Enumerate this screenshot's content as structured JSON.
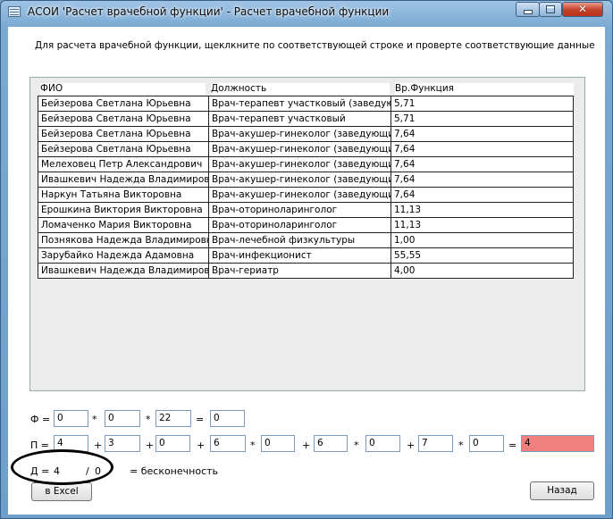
{
  "window": {
    "title": "АСОИ 'Расчет врачебной функции' - Расчет врачебной функции",
    "icon": "app-window-icon"
  },
  "instruction": "Для расчета врачебной функции, щеклкните по соответствующей строке и проверте соответствующие данные",
  "grid": {
    "headers": [
      "ФИО",
      "Должность",
      "Вр.Функция"
    ],
    "rows": [
      [
        "Бейзерова Светлана Юрьевна",
        "Врач-терапевт участковый (заведующи",
        "5,71"
      ],
      [
        "Бейзерова Светлана Юрьевна",
        "Врач-терапевт участковый",
        "5,71"
      ],
      [
        "Бейзерова Светлана Юрьевна",
        "Врач-акушер-гинеколог (заведующий)",
        "7,64"
      ],
      [
        "Бейзерова Светлана Юрьевна",
        "Врач-акушер-гинеколог (заведующий)",
        "7,64"
      ],
      [
        "Мелеховец Петр Александрович",
        "Врач-акушер-гинеколог (заведующий)",
        "7,64"
      ],
      [
        "Ивашкевич Надежда Владимировна",
        "Врач-акушер-гинеколог (заведующий)",
        "7,64"
      ],
      [
        "Наркун Татьяна Викторовна",
        "Врач-акушер-гинеколог (заведующий)",
        "7,64"
      ],
      [
        "Ерошкина Виктория Викторовна",
        "Врач-оториноларинголог",
        "11,13"
      ],
      [
        "Ломаченко Мария Викторовна",
        "Врач-оториноларинголог",
        "11,13"
      ],
      [
        "Познякова Надежда Владимировна",
        "Врач-лечебной физкультуры",
        "1,00"
      ],
      [
        "Зарубайко Надежда Адамовна",
        "Врач-инфекционист",
        "55,55"
      ],
      [
        "Ивашкевич Надежда Владимировна",
        "Врач-гериатр",
        "4,00"
      ]
    ]
  },
  "formula_phi": {
    "label": "Ф =",
    "values": [
      "0",
      "0",
      "22"
    ],
    "ops": [
      "*",
      "*",
      "="
    ],
    "result": "0"
  },
  "formula_pi": {
    "label": "П =",
    "values": [
      "4",
      "3",
      "0",
      "6",
      "0",
      "6",
      "0",
      "7",
      "0"
    ],
    "ops": [
      "+",
      "+",
      "+",
      "*",
      "+",
      "*",
      "+",
      "*",
      "="
    ],
    "result": "4"
  },
  "formula_d": {
    "label": "Д =",
    "numerator": "4",
    "slash": "/",
    "denominator": "0",
    "result": "= бесконечность"
  },
  "buttons": {
    "excel": "в Excel",
    "back": "Назад"
  },
  "colors": {
    "result_highlight": "#f08080",
    "annotation_ellipse": "#000000"
  }
}
